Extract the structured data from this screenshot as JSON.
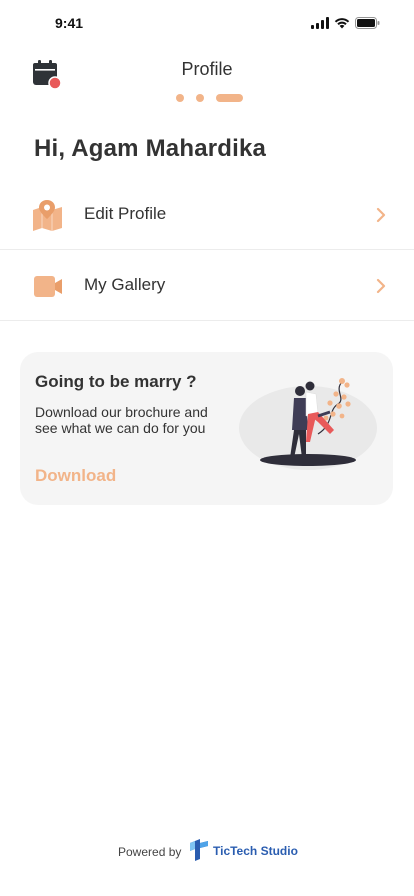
{
  "status_bar": {
    "time": "9:41",
    "icons": [
      "signal-icon",
      "wifi-icon",
      "battery-icon"
    ]
  },
  "header": {
    "title": "Profile",
    "calendar_icon": "calendar-icon",
    "notification_dot_color": "#E85A5A",
    "page_indicator": {
      "pages": 3,
      "active_index": 2
    }
  },
  "greeting": "Hi, Agam Mahardika",
  "menu": {
    "items": [
      {
        "label": "Edit Profile",
        "icon": "map-pin-icon"
      },
      {
        "label": "My Gallery",
        "icon": "video-camera-icon"
      }
    ]
  },
  "promo": {
    "title": "Going to be marry ?",
    "text": "Download our brochure and see what we can do for you",
    "link": "Download",
    "illustration": "couple-illustration"
  },
  "footer": {
    "powered_by": "Powered by",
    "brand": "TicTech Studio"
  },
  "colors": {
    "accent": "#F2B489",
    "text": "#333333",
    "card_bg": "#F5F5F5",
    "brand_blue": "#2A5DB0"
  }
}
